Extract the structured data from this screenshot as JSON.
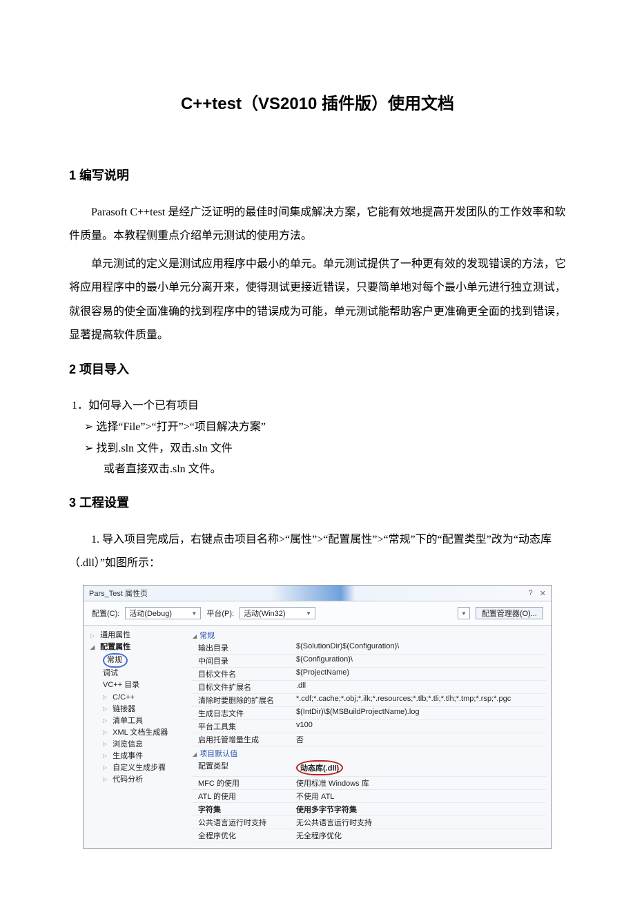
{
  "title": "C++test（VS2010 插件版）使用文档",
  "sections": {
    "s1": {
      "heading": "1 编写说明",
      "p1": "Parasoft C++test 是经广泛证明的最佳时间集成解决方案，它能有效地提高开发团队的工作效率和软件质量。本教程侧重点介绍单元测试的使用方法。",
      "p2": "单元测试的定义是测试应用程序中最小的单元。单元测试提供了一种更有效的发现错误的方法，它将应用程序中的最小单元分离开来，使得测试更接近错误，只要简单地对每个最小单元进行独立测试，就很容易的使全面准确的找到程序中的错误成为可能，单元测试能帮助客户更准确更全面的找到错误，显著提高软件质量。"
    },
    "s2": {
      "heading": "2 项目导入",
      "l1": "1．如何导入一个已有项目",
      "b1": "➢  选择“File”>“打开”>“项目解决方案”",
      "b2": "➢  找到.sln 文件，双击.sln 文件",
      "b2_sub": "或者直接双击.sln 文件。"
    },
    "s3": {
      "heading": "3 工程设置",
      "p1": "1. 导入项目完成后，右键点击项目名称>“属性”>“配置属性”>“常规”下的“配置类型”改为“动态库（.dll）”如图所示："
    }
  },
  "dialog": {
    "title": "Pars_Test 属性页",
    "win_help": "?",
    "win_close": "✕",
    "toolbar": {
      "config_label": "配置(C):",
      "config_value": "活动(Debug)",
      "platform_label": "平台(P):",
      "platform_value": "活动(Win32)",
      "mgr_button": "配置管理器(O)..."
    },
    "tree": {
      "common": "通用属性",
      "cfgprops": "配置属性",
      "general": "常规",
      "debug": "调试",
      "vcdir": "VC++ 目录",
      "cc": "C/C++",
      "linker": "链接器",
      "manifest": "清单工具",
      "xmldoc": "XML 文档生成器",
      "browse": "浏览信息",
      "build": "生成事件",
      "custom": "自定义生成步骤",
      "codeanalysis": "代码分析"
    },
    "groups": {
      "g1": "常规",
      "g2": "项目默认值"
    },
    "props": {
      "outdir_k": "输出目录",
      "outdir_v": "$(SolutionDir)$(Configuration)\\",
      "intdir_k": "中间目录",
      "intdir_v": "$(Configuration)\\",
      "target_k": "目标文件名",
      "target_v": "$(ProjectName)",
      "ext_k": "目标文件扩展名",
      "ext_v": ".dll",
      "clean_k": "清除时要删除的扩展名",
      "clean_v": "*.cdf;*.cache;*.obj;*.ilk;*.resources;*.tlb;*.tli;*.tlh;*.tmp;*.rsp;*.pgc",
      "log_k": "生成日志文件",
      "log_v": "$(IntDir)\\$(MSBuildProjectName).log",
      "toolset_k": "平台工具集",
      "toolset_v": "v100",
      "managed_k": "启用托管增量生成",
      "managed_v": "否",
      "cfgtype_k": "配置类型",
      "cfgtype_v": "动态库(.dll)",
      "mfc_k": "MFC 的使用",
      "mfc_v": "使用标准 Windows 库",
      "atl_k": "ATL 的使用",
      "atl_v": "不使用 ATL",
      "charset_k": "字符集",
      "charset_v": "使用多字节字符集",
      "clr_k": "公共语言运行时支持",
      "clr_v": "无公共语言运行时支持",
      "wpo_k": "全程序优化",
      "wpo_v": "无全程序优化"
    }
  }
}
